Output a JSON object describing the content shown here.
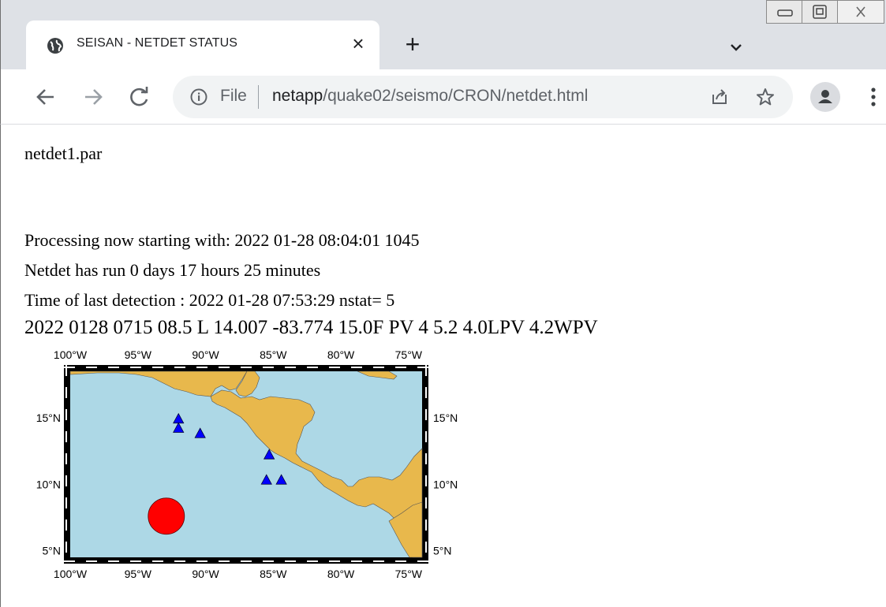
{
  "browser": {
    "tab": {
      "title": "SEISAN - NETDET STATUS",
      "close_icon": "close-icon"
    },
    "new_tab_icon": "plus-icon",
    "tab_search_icon": "chevron-down-icon",
    "window_controls": [
      "minimize-icon",
      "restore-icon",
      "close-icon"
    ],
    "address_bar": {
      "security_icon": "info-icon",
      "scheme_label": "File",
      "url_host": "netapp",
      "url_path": "/quake02/seismo/CRON/netdet.html"
    },
    "toolbar_icons": [
      "back-arrow-icon",
      "forward-arrow-icon",
      "reload-icon",
      "share-icon",
      "star-icon",
      "profile-icon",
      "menu-icon"
    ]
  },
  "page": {
    "par_file": "netdet1.par",
    "processing_line": "Processing now starting with: 2022 01-28 08:04:01 1045",
    "runtime_line": "Netdet has run 0 days 17 hours 25 minutes",
    "last_detection_line": "Time of last detection : 2022 01-28 07:53:29 nstat= 5",
    "event_line": "2022 0128 0715 08.5 L 14.007 -83.774 15.0F PV 4 5.2 4.0LPV 4.2WPV"
  },
  "map": {
    "x_ticks": [
      "100°W",
      "95°W",
      "90°W",
      "85°W",
      "80°W",
      "75°W"
    ],
    "y_ticks": [
      "15°N",
      "10°N",
      "5°N"
    ],
    "lon_range": [
      -100,
      -74
    ],
    "lat_range": [
      4.5,
      18.5
    ],
    "stations": [
      {
        "lon": -92.0,
        "lat": 14.9
      },
      {
        "lon": -92.0,
        "lat": 14.2
      },
      {
        "lon": -90.4,
        "lat": 13.8
      },
      {
        "lon": -85.3,
        "lat": 12.2
      },
      {
        "lon": -85.5,
        "lat": 10.3
      },
      {
        "lon": -84.4,
        "lat": 10.3
      }
    ],
    "event": {
      "lon": -92.9,
      "lat": 7.6
    },
    "colors": {
      "ocean": "#add8e6",
      "land": "#e8b84c",
      "station": "#0000ff",
      "event": "#ff0000"
    }
  }
}
